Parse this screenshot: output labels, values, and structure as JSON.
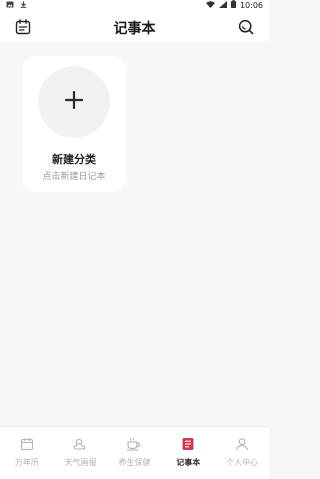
{
  "status_bar": {
    "time": "10:06",
    "left_icons": [
      "image-notification-icon",
      "download-notification-icon"
    ],
    "right_icons": [
      "wifi-icon",
      "signal-icon",
      "battery-icon"
    ]
  },
  "header": {
    "title": "记事本",
    "left_icon": "calendar-icon",
    "right_icon": "search-icon"
  },
  "card": {
    "title": "新建分类",
    "subtitle": "点击新建日记本",
    "icon": "plus-icon"
  },
  "tabs": [
    {
      "label": "万年历",
      "icon": "calendar-icon",
      "active": false
    },
    {
      "label": "天气画报",
      "icon": "weather-icon",
      "active": false
    },
    {
      "label": "养生保健",
      "icon": "tea-cup-icon",
      "active": false
    },
    {
      "label": "记事本",
      "icon": "notebook-icon",
      "active": true
    },
    {
      "label": "个人中心",
      "icon": "person-icon",
      "active": false
    }
  ],
  "colors": {
    "background": "#f7f7f7",
    "active_tab": "#d9364a",
    "inactive_tab": "#b3b3b3"
  }
}
